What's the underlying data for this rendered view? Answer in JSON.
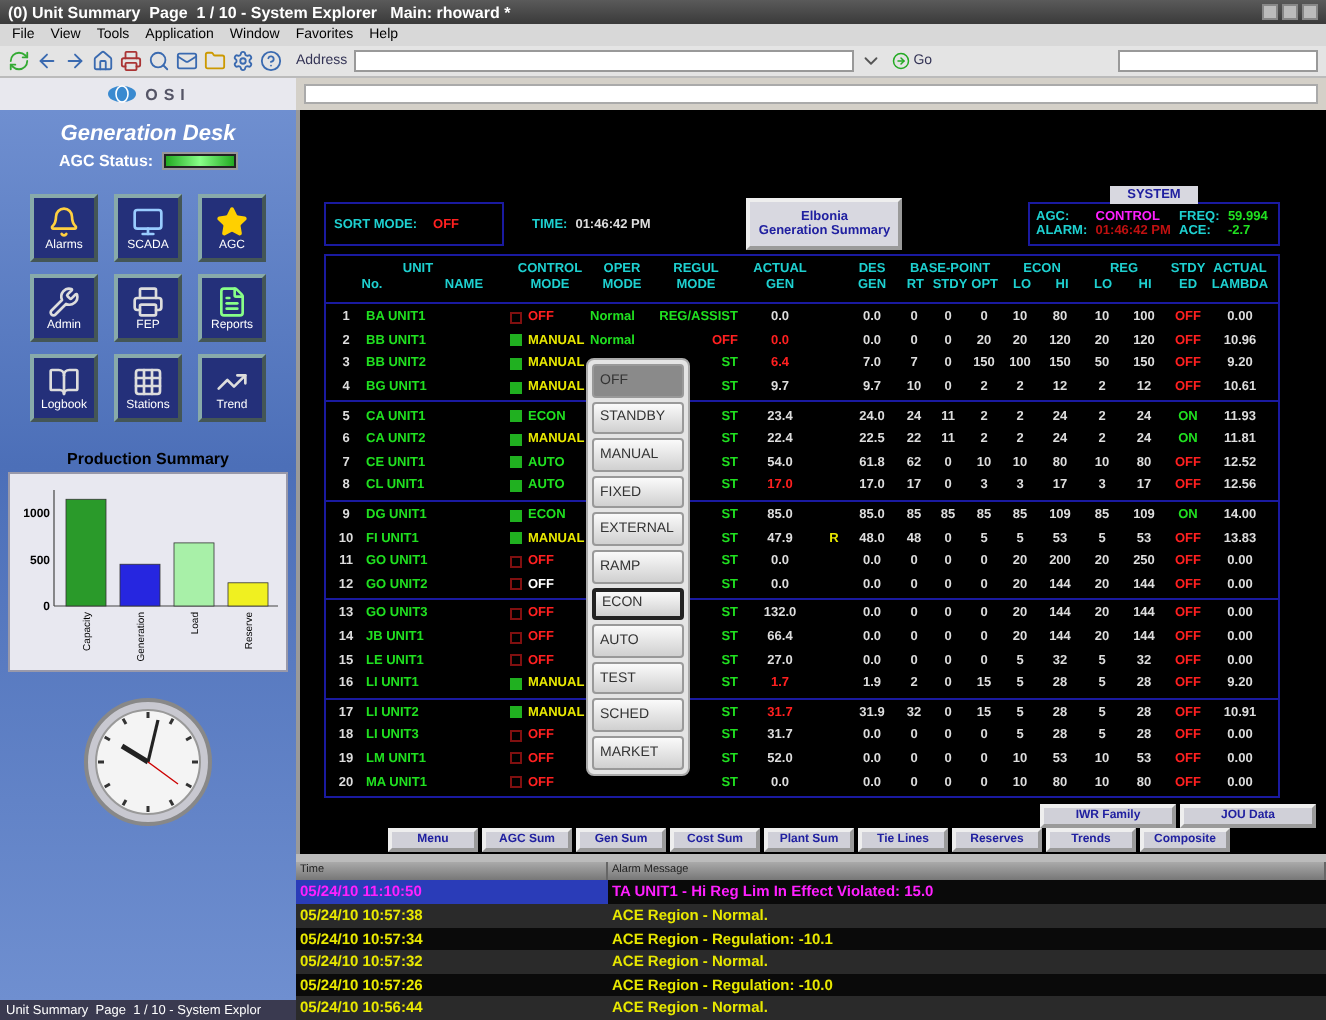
{
  "window": {
    "title": "(0) Unit Summary  Page  1 / 10 - System Explorer   Main: rhoward *"
  },
  "menu": [
    "File",
    "View",
    "Tools",
    "Application",
    "Window",
    "Favorites",
    "Help"
  ],
  "toolbar": {
    "address_label": "Address",
    "go": "Go"
  },
  "logo": {
    "text": "OSI"
  },
  "desk": {
    "title": "Generation Desk",
    "agc_status_label": "AGC Status:",
    "tiles": [
      {
        "kind": "bell",
        "label": "Alarms"
      },
      {
        "kind": "monitor",
        "label": "SCADA"
      },
      {
        "kind": "star",
        "label": "AGC"
      },
      {
        "kind": "wrench",
        "label": "Admin"
      },
      {
        "kind": "printer",
        "label": "FEP"
      },
      {
        "kind": "file",
        "label": "Reports"
      },
      {
        "kind": "book",
        "label": "Logbook"
      },
      {
        "kind": "grid",
        "label": "Stations"
      },
      {
        "kind": "trend",
        "label": "Trend"
      }
    ],
    "production": {
      "title": "Production Summary",
      "chart_data": {
        "type": "bar",
        "categories": [
          "Capacity",
          "Generation",
          "Load",
          "Reserve"
        ],
        "values": [
          1150,
          450,
          680,
          250
        ],
        "colors": [
          "#2a9a2a",
          "#2626e0",
          "#a8f0a8",
          "#f0f020"
        ],
        "ylim": [
          0,
          1250
        ],
        "yticks": [
          0,
          500,
          1000
        ]
      }
    }
  },
  "status_bar": "Unit Summary  Page  1 / 10 - System Explor",
  "summary": {
    "sort_label": "SORT MODE:",
    "sort_value": "OFF",
    "time_label": "TIME:",
    "time_value": "01:46:42 PM",
    "area_button": [
      "Elbonia",
      "Generation Summary"
    ],
    "system": {
      "tab": "SYSTEM",
      "agc_label": "AGC:",
      "agc_value": "CONTROL",
      "freq_label": "FREQ:",
      "freq_value": "59.994",
      "alarm_label": "ALARM:",
      "alarm_value": "01:46:42 PM",
      "ace_label": "ACE:",
      "ace_value": "-2.7"
    }
  },
  "table": {
    "header": [
      {
        "kind": "group",
        "label": "UNIT",
        "columns": [
          "No.",
          "NAME"
        ]
      },
      {
        "kind": "single",
        "lines": [
          "CONTROL",
          "MODE"
        ]
      },
      {
        "kind": "single",
        "lines": [
          "OPER",
          "MODE"
        ]
      },
      {
        "kind": "single",
        "lines": [
          "REGUL",
          "MODE"
        ]
      },
      {
        "kind": "single",
        "lines": [
          "ACTUAL",
          "GEN"
        ]
      },
      {
        "kind": "blank"
      },
      {
        "kind": "single",
        "lines": [
          "DES",
          "GEN"
        ]
      },
      {
        "kind": "group",
        "label": "BASE-POINT",
        "columns": [
          "RT",
          "STDY",
          "OPT"
        ]
      },
      {
        "kind": "group",
        "label": "ECON",
        "columns": [
          "LO",
          "HI"
        ]
      },
      {
        "kind": "group",
        "label": "REG",
        "columns": [
          "LO",
          "HI"
        ]
      },
      {
        "kind": "single",
        "lines": [
          "STDY",
          "ED"
        ]
      },
      {
        "kind": "single",
        "lines": [
          "ACTUAL",
          "LAMBDA"
        ]
      }
    ],
    "row_groups": [
      {
        "rows": [
          {
            "no": "1",
            "name": "BA UNIT1",
            "control_on": false,
            "control_mode": "OFF",
            "color": "#ff2020",
            "oper_mode": "Normal",
            "regul_mode": "REG/ASSIST",
            "regul_alarm": false,
            "actual_gen": "0.0",
            "gen_alarm": false,
            "des_gen": "0.0",
            "rt": "0",
            "stdy": "0",
            "opt": "0",
            "econ_lo": "10",
            "econ_hi": "80",
            "reg_lo": "10",
            "reg_hi": "100",
            "stdy_ed": "OFF",
            "stdy_on": false,
            "lambda": "0.00"
          },
          {
            "no": "2",
            "name": "BB UNIT1",
            "control_on": true,
            "control_mode": "MANUAL",
            "color": "#e8e800",
            "oper_mode": "Normal",
            "regul_mode": "OFF",
            "regul_alarm": true,
            "actual_gen": "0.0",
            "gen_alarm": true,
            "des_gen": "0.0",
            "rt": "0",
            "stdy": "0",
            "opt": "20",
            "econ_lo": "20",
            "econ_hi": "120",
            "reg_lo": "20",
            "reg_hi": "120",
            "stdy_ed": "OFF",
            "stdy_on": false,
            "lambda": "10.96"
          },
          {
            "no": "3",
            "name": "BB UNIT2",
            "control_on": true,
            "control_mode": "MANUAL",
            "color": "#e8e800",
            "regul_mode": "ST",
            "regul_alarm": false,
            "actual_gen": "6.4",
            "gen_alarm": true,
            "des_gen": "7.0",
            "rt": "7",
            "stdy": "0",
            "opt": "150",
            "econ_lo": "100",
            "econ_hi": "150",
            "reg_lo": "50",
            "reg_hi": "150",
            "stdy_ed": "OFF",
            "stdy_on": false,
            "lambda": "9.20"
          },
          {
            "no": "4",
            "name": "BG UNIT1",
            "control_on": true,
            "control_mode": "MANUAL",
            "color": "#e8e800",
            "regul_mode": "ST",
            "regul_alarm": false,
            "actual_gen": "9.7",
            "gen_alarm": false,
            "des_gen": "9.7",
            "rt": "10",
            "stdy": "0",
            "opt": "2",
            "econ_lo": "2",
            "econ_hi": "12",
            "reg_lo": "2",
            "reg_hi": "12",
            "stdy_ed": "OFF",
            "stdy_on": false,
            "lambda": "10.61"
          }
        ]
      },
      {
        "rows": [
          {
            "no": "5",
            "name": "CA UNIT1",
            "control_on": true,
            "control_mode": "ECON",
            "color": "#20e020",
            "regul_mode": "ST",
            "regul_alarm": false,
            "actual_gen": "23.4",
            "gen_alarm": false,
            "des_gen": "24.0",
            "rt": "24",
            "stdy": "11",
            "opt": "2",
            "econ_lo": "2",
            "econ_hi": "24",
            "reg_lo": "2",
            "reg_hi": "24",
            "stdy_ed": "ON",
            "stdy_on": true,
            "lambda": "11.93"
          },
          {
            "no": "6",
            "name": "CA UNIT2",
            "control_on": true,
            "control_mode": "MANUAL",
            "color": "#e8e800",
            "regul_mode": "ST",
            "regul_alarm": false,
            "actual_gen": "22.4",
            "gen_alarm": false,
            "des_gen": "22.5",
            "rt": "22",
            "stdy": "11",
            "opt": "2",
            "econ_lo": "2",
            "econ_hi": "24",
            "reg_lo": "2",
            "reg_hi": "24",
            "stdy_ed": "ON",
            "stdy_on": true,
            "lambda": "11.81"
          },
          {
            "no": "7",
            "name": "CE UNIT1",
            "control_on": true,
            "control_mode": "AUTO",
            "color": "#20e020",
            "regul_mode": "ST",
            "regul_alarm": false,
            "actual_gen": "54.0",
            "gen_alarm": false,
            "des_gen": "61.8",
            "rt": "62",
            "stdy": "0",
            "opt": "10",
            "econ_lo": "10",
            "econ_hi": "80",
            "reg_lo": "10",
            "reg_hi": "80",
            "stdy_ed": "OFF",
            "stdy_on": false,
            "lambda": "12.52"
          },
          {
            "no": "8",
            "name": "CL UNIT1",
            "control_on": true,
            "control_mode": "AUTO",
            "color": "#20e020",
            "regul_mode": "ST",
            "regul_alarm": false,
            "actual_gen": "17.0",
            "gen_alarm": true,
            "des_gen": "17.0",
            "rt": "17",
            "stdy": "0",
            "opt": "3",
            "econ_lo": "3",
            "econ_hi": "17",
            "reg_lo": "3",
            "reg_hi": "17",
            "stdy_ed": "OFF",
            "stdy_on": false,
            "lambda": "12.56"
          }
        ]
      },
      {
        "rows": [
          {
            "no": "9",
            "name": "DG UNIT1",
            "control_on": true,
            "control_mode": "ECON",
            "color": "#20e020",
            "regul_mode": "ST",
            "regul_alarm": false,
            "actual_gen": "85.0",
            "gen_alarm": false,
            "des_gen": "85.0",
            "rt": "85",
            "stdy": "85",
            "opt": "85",
            "econ_lo": "85",
            "econ_hi": "109",
            "reg_lo": "85",
            "reg_hi": "109",
            "stdy_ed": "ON",
            "stdy_on": true,
            "lambda": "14.00"
          },
          {
            "no": "10",
            "name": "FI UNIT1",
            "control_on": true,
            "control_mode": "MANUAL",
            "color": "#e8e800",
            "regul_mode": "ST",
            "regul_alarm": false,
            "actual_gen": "47.9",
            "gen_alarm": false,
            "flag": "R",
            "des_gen": "48.0",
            "rt": "48",
            "stdy": "0",
            "opt": "5",
            "econ_lo": "5",
            "econ_hi": "53",
            "reg_lo": "5",
            "reg_hi": "53",
            "stdy_ed": "OFF",
            "stdy_on": false,
            "lambda": "13.83"
          },
          {
            "no": "11",
            "name": "GO UNIT1",
            "control_on": false,
            "control_mode": "OFF",
            "color": "#ff2020",
            "regul_mode": "ST",
            "regul_alarm": false,
            "actual_gen": "0.0",
            "gen_alarm": false,
            "des_gen": "0.0",
            "rt": "0",
            "stdy": "0",
            "opt": "0",
            "econ_lo": "20",
            "econ_hi": "200",
            "reg_lo": "20",
            "reg_hi": "250",
            "stdy_ed": "OFF",
            "stdy_on": false,
            "lambda": "0.00"
          },
          {
            "no": "12",
            "name": "GO UNIT2",
            "control_on": false,
            "control_mode": "OFF",
            "color": "#ffffff",
            "regul_mode": "ST",
            "regul_alarm": false,
            "actual_gen": "0.0",
            "gen_alarm": false,
            "des_gen": "0.0",
            "rt": "0",
            "stdy": "0",
            "opt": "0",
            "econ_lo": "20",
            "econ_hi": "144",
            "reg_lo": "20",
            "reg_hi": "144",
            "stdy_ed": "OFF",
            "stdy_on": false,
            "lambda": "0.00"
          }
        ]
      },
      {
        "rows": [
          {
            "no": "13",
            "name": "GO UNIT3",
            "control_on": false,
            "control_mode": "OFF",
            "color": "#ff2020",
            "regul_mode": "ST",
            "regul_alarm": false,
            "actual_gen": "132.0",
            "gen_alarm": false,
            "des_gen": "0.0",
            "rt": "0",
            "stdy": "0",
            "opt": "0",
            "econ_lo": "20",
            "econ_hi": "144",
            "reg_lo": "20",
            "reg_hi": "144",
            "stdy_ed": "OFF",
            "stdy_on": false,
            "lambda": "0.00"
          },
          {
            "no": "14",
            "name": "JB UNIT1",
            "control_on": false,
            "control_mode": "OFF",
            "color": "#ff2020",
            "regul_mode": "ST",
            "regul_alarm": false,
            "actual_gen": "66.4",
            "gen_alarm": false,
            "des_gen": "0.0",
            "rt": "0",
            "stdy": "0",
            "opt": "0",
            "econ_lo": "20",
            "econ_hi": "144",
            "reg_lo": "20",
            "reg_hi": "144",
            "stdy_ed": "OFF",
            "stdy_on": false,
            "lambda": "0.00"
          },
          {
            "no": "15",
            "name": "LE UNIT1",
            "control_on": false,
            "control_mode": "OFF",
            "color": "#ff2020",
            "regul_mode": "ST",
            "regul_alarm": false,
            "actual_gen": "27.0",
            "gen_alarm": false,
            "des_gen": "0.0",
            "rt": "0",
            "stdy": "0",
            "opt": "0",
            "econ_lo": "5",
            "econ_hi": "32",
            "reg_lo": "5",
            "reg_hi": "32",
            "stdy_ed": "OFF",
            "stdy_on": false,
            "lambda": "0.00"
          },
          {
            "no": "16",
            "name": "LI UNIT1",
            "control_on": true,
            "control_mode": "MANUAL",
            "color": "#e8e800",
            "regul_mode": "ST",
            "regul_alarm": false,
            "actual_gen": "1.7",
            "gen_alarm": true,
            "des_gen": "1.9",
            "rt": "2",
            "stdy": "0",
            "opt": "15",
            "econ_lo": "5",
            "econ_hi": "28",
            "reg_lo": "5",
            "reg_hi": "28",
            "stdy_ed": "OFF",
            "stdy_on": false,
            "lambda": "9.20"
          }
        ]
      },
      {
        "rows": [
          {
            "no": "17",
            "name": "LI UNIT2",
            "control_on": true,
            "control_mode": "MANUAL",
            "color": "#e8e800",
            "regul_mode": "ST",
            "regul_alarm": false,
            "actual_gen": "31.7",
            "gen_alarm": true,
            "des_gen": "31.9",
            "rt": "32",
            "stdy": "0",
            "opt": "15",
            "econ_lo": "5",
            "econ_hi": "28",
            "reg_lo": "5",
            "reg_hi": "28",
            "stdy_ed": "OFF",
            "stdy_on": false,
            "lambda": "10.91"
          },
          {
            "no": "18",
            "name": "LI UNIT3",
            "control_on": false,
            "control_mode": "OFF",
            "color": "#ff2020",
            "regul_mode": "ST",
            "regul_alarm": false,
            "actual_gen": "31.7",
            "gen_alarm": false,
            "des_gen": "0.0",
            "rt": "0",
            "stdy": "0",
            "opt": "0",
            "econ_lo": "5",
            "econ_hi": "28",
            "reg_lo": "5",
            "reg_hi": "28",
            "stdy_ed": "OFF",
            "stdy_on": false,
            "lambda": "0.00"
          },
          {
            "no": "19",
            "name": "LM UNIT1",
            "control_on": false,
            "control_mode": "OFF",
            "color": "#ff2020",
            "regul_mode": "ST",
            "regul_alarm": false,
            "actual_gen": "52.0",
            "gen_alarm": false,
            "des_gen": "0.0",
            "rt": "0",
            "stdy": "0",
            "opt": "0",
            "econ_lo": "10",
            "econ_hi": "53",
            "reg_lo": "10",
            "reg_hi": "53",
            "stdy_ed": "OFF",
            "stdy_on": false,
            "lambda": "0.00"
          },
          {
            "no": "20",
            "name": "MA UNIT1",
            "control_on": false,
            "control_mode": "OFF",
            "color": "#ff2020",
            "regul_mode": "ST",
            "regul_alarm": false,
            "actual_gen": "0.0",
            "gen_alarm": false,
            "des_gen": "0.0",
            "rt": "0",
            "stdy": "0",
            "opt": "0",
            "econ_lo": "10",
            "econ_hi": "80",
            "reg_lo": "10",
            "reg_hi": "80",
            "stdy_ed": "OFF",
            "stdy_on": false,
            "lambda": "0.00"
          }
        ]
      }
    ]
  },
  "mode_menu": [
    {
      "label": "OFF",
      "selected": true,
      "focused": false
    },
    {
      "label": "STANDBY",
      "selected": false,
      "focused": false
    },
    {
      "label": "MANUAL",
      "selected": false,
      "focused": false
    },
    {
      "label": "FIXED",
      "selected": false,
      "focused": false
    },
    {
      "label": "EXTERNAL",
      "selected": false,
      "focused": false
    },
    {
      "label": "RAMP",
      "selected": false,
      "focused": false
    },
    {
      "label": "ECON",
      "selected": false,
      "focused": true
    },
    {
      "label": "AUTO",
      "selected": false,
      "focused": false
    },
    {
      "label": "TEST",
      "selected": false,
      "focused": false
    },
    {
      "label": "SCHED",
      "selected": false,
      "focused": false
    },
    {
      "label": "MARKET",
      "selected": false,
      "focused": false
    }
  ],
  "nav_buttons_top": [
    "IWR Family",
    "JOU Data"
  ],
  "nav_buttons": [
    "Menu",
    "AGC Sum",
    "Gen Sum",
    "Cost Sum",
    "Plant Sum",
    "Tie Lines",
    "Reserves",
    "Trends",
    "Composite"
  ],
  "alarms": {
    "columns": [
      "Time",
      "Alarm Message"
    ],
    "rows": [
      {
        "time": "05/24/10 11:10:50",
        "message": "TA UNIT1 - Hi Reg Lim In Effect Violated: 15.0",
        "selected": true,
        "alert": true
      },
      {
        "time": "05/24/10 10:57:38",
        "message": "ACE Region - Normal.",
        "selected": false,
        "alert": false
      },
      {
        "time": "05/24/10 10:57:34",
        "message": "ACE Region - Regulation: -10.1",
        "selected": false,
        "alert": false
      },
      {
        "time": "05/24/10 10:57:32",
        "message": "ACE Region - Normal.",
        "selected": false,
        "alert": false
      },
      {
        "time": "05/24/10 10:57:26",
        "message": "ACE Region - Regulation: -10.0",
        "selected": false,
        "alert": false
      },
      {
        "time": "05/24/10 10:56:44",
        "message": "ACE Region - Normal.",
        "selected": false,
        "alert": false
      }
    ]
  }
}
